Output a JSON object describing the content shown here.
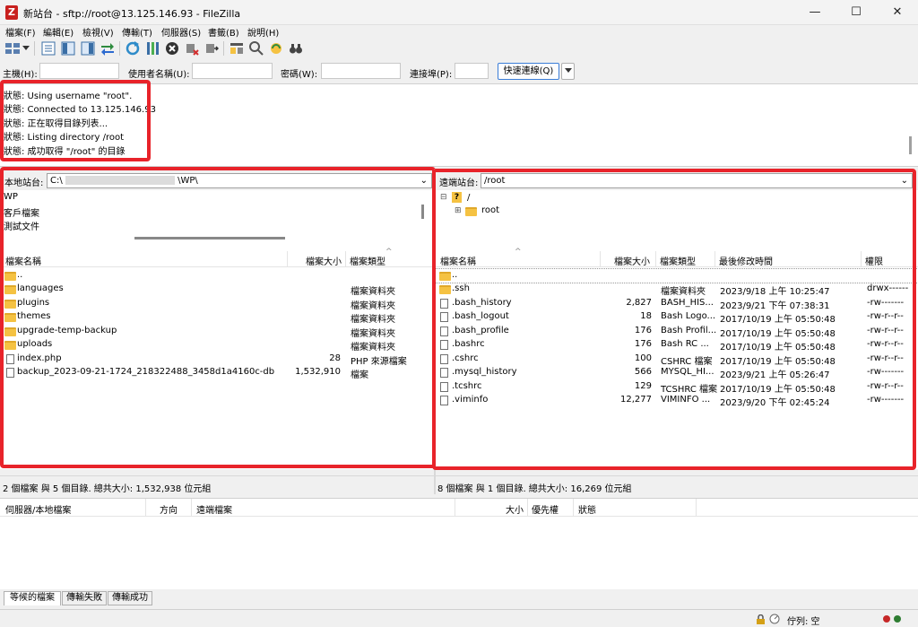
{
  "window": {
    "title": "新站台 - sftp://root@13.125.146.93 - FileZilla",
    "app_icon": "filezilla-icon",
    "minimize_icon": "minimize-icon",
    "maximize_icon": "maximize-icon",
    "close_icon": "close-icon"
  },
  "menu": [
    "檔案(F)",
    "編輯(E)",
    "檢視(V)",
    "傳輸(T)",
    "伺服器(S)",
    "書籤(B)",
    "說明(H)"
  ],
  "toolbar": {
    "icons": [
      "site-manager-icon",
      "dropdown-arrow-icon",
      "toggle-log-icon",
      "toggle-local-tree-icon",
      "toggle-remote-tree-icon",
      "toggle-queue-icon",
      "refresh-icon",
      "process-queue-icon",
      "cancel-icon",
      "disconnect-icon",
      "reconnect-icon",
      "directory-comparison-icon",
      "filter-icon",
      "sync-browse-icon",
      "search-icon"
    ]
  },
  "quickconnect": {
    "host_label": "主機(H):",
    "user_label": "使用者名稱(U):",
    "pass_label": "密碼(W):",
    "port_label": "連接埠(P):",
    "button_label": "快速連線(Q)",
    "host_value": "",
    "user_value": "",
    "pass_value": "",
    "port_value": ""
  },
  "log": [
    "狀態:  Using username \"root\".",
    "狀態:  Connected to 13.125.146.93",
    "狀態:  正在取得目錄列表...",
    "狀態:  Listing directory /root",
    "狀態:  成功取得 \"/root\" 的目錄"
  ],
  "local": {
    "site_label": "本地站台:",
    "path_start": "C:\\",
    "path_end": "\\WP\\",
    "tree": [
      "WP",
      "客戶檔案",
      "測試文件"
    ],
    "headers": {
      "name": "檔案名稱",
      "size": "檔案大小",
      "type": "檔案類型"
    },
    "rows": [
      {
        "name": "..",
        "size": "",
        "type": "",
        "icon": "folder-icon"
      },
      {
        "name": "languages",
        "size": "",
        "type": "檔案資料夾",
        "icon": "folder-icon"
      },
      {
        "name": "plugins",
        "size": "",
        "type": "檔案資料夾",
        "icon": "folder-icon"
      },
      {
        "name": "themes",
        "size": "",
        "type": "檔案資料夾",
        "icon": "folder-icon"
      },
      {
        "name": "upgrade-temp-backup",
        "size": "",
        "type": "檔案資料夾",
        "icon": "folder-icon"
      },
      {
        "name": "uploads",
        "size": "",
        "type": "檔案資料夾",
        "icon": "folder-icon"
      },
      {
        "name": "index.php",
        "size": "28",
        "type": "PHP 來源檔案",
        "icon": "file-icon"
      },
      {
        "name": "backup_2023-09-21-1724_218322488_3458d1a4160c-db",
        "size": "1,532,910",
        "type": "檔案",
        "icon": "file-icon"
      }
    ],
    "status": "2 個檔案 與 5 個目錄. 總共大小: 1,532,938 位元組"
  },
  "remote": {
    "site_label": "遠端站台:",
    "path": "/root",
    "tree": [
      "/",
      "root"
    ],
    "headers": {
      "name": "檔案名稱",
      "size": "檔案大小",
      "type": "檔案類型",
      "modified": "最後修改時間",
      "perms": "權限"
    },
    "rows": [
      {
        "name": "..",
        "size": "",
        "type": "",
        "modified": "",
        "perms": "",
        "icon": "folder-icon"
      },
      {
        "name": ".ssh",
        "size": "",
        "type": "檔案資料夾",
        "modified": "2023/9/18 上午 10:25:47",
        "perms": "drwx------",
        "icon": "folder-icon"
      },
      {
        "name": ".bash_history",
        "size": "2,827",
        "type": "BASH_HIS...",
        "modified": "2023/9/21 下午 07:38:31",
        "perms": "-rw-------",
        "icon": "file-icon"
      },
      {
        "name": ".bash_logout",
        "size": "18",
        "type": "Bash Logo...",
        "modified": "2017/10/19 上午 05:50:48",
        "perms": "-rw-r--r--",
        "icon": "file-icon"
      },
      {
        "name": ".bash_profile",
        "size": "176",
        "type": "Bash Profil...",
        "modified": "2017/10/19 上午 05:50:48",
        "perms": "-rw-r--r--",
        "icon": "file-icon"
      },
      {
        "name": ".bashrc",
        "size": "176",
        "type": "Bash RC ...",
        "modified": "2017/10/19 上午 05:50:48",
        "perms": "-rw-r--r--",
        "icon": "file-icon"
      },
      {
        "name": ".cshrc",
        "size": "100",
        "type": "CSHRC 檔案",
        "modified": "2017/10/19 上午 05:50:48",
        "perms": "-rw-r--r--",
        "icon": "file-icon"
      },
      {
        "name": ".mysql_history",
        "size": "566",
        "type": "MYSQL_HI...",
        "modified": "2023/9/21 上午 05:26:47",
        "perms": "-rw-------",
        "icon": "file-icon"
      },
      {
        "name": ".tcshrc",
        "size": "129",
        "type": "TCSHRC 檔案",
        "modified": "2017/10/19 上午 05:50:48",
        "perms": "-rw-r--r--",
        "icon": "file-icon"
      },
      {
        "name": ".viminfo",
        "size": "12,277",
        "type": "VIMINFO ...",
        "modified": "2023/9/20 下午 02:45:24",
        "perms": "-rw-------",
        "icon": "file-icon"
      }
    ],
    "status": "8 個檔案 與 1 個目錄. 總共大小: 16,269 位元組"
  },
  "queue": {
    "headers": [
      "伺服器/本地檔案",
      "方向",
      "遠端檔案",
      "大小",
      "優先權",
      "狀態"
    ]
  },
  "tabs": [
    "等候的檔案",
    "傳輸失敗",
    "傳輸成功"
  ],
  "statusbar": {
    "queue_text": "佇列: 空",
    "lock_icon": "lock-icon",
    "speed_icon": "speed-limit-icon",
    "led_icons": [
      "recv-led-icon",
      "send-led-icon"
    ]
  },
  "colors": {
    "annotation_red": "#e8232a",
    "accent_blue": "#3b7dd8"
  }
}
